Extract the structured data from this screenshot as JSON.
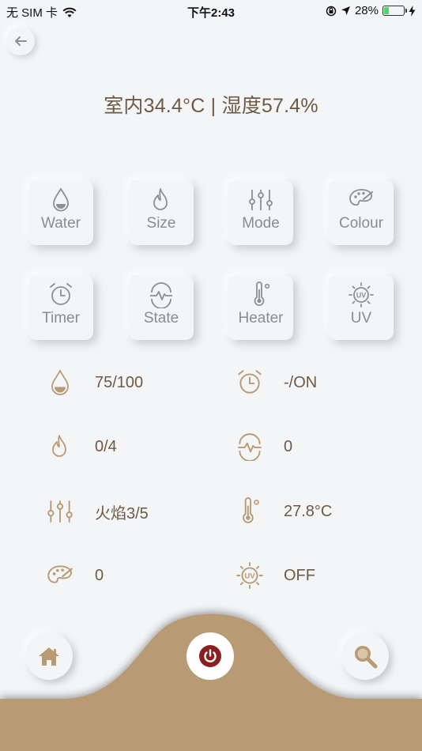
{
  "status_bar": {
    "carrier": "无 SIM 卡",
    "time": "下午2:43",
    "battery_percent": "28%",
    "battery_level": 0.28
  },
  "header": {
    "climate_readout": "室内34.4°C | 湿度57.4%"
  },
  "controls": {
    "row1": [
      {
        "label": "Water",
        "icon": "water-drop-icon"
      },
      {
        "label": "Size",
        "icon": "flame-icon"
      },
      {
        "label": "Mode",
        "icon": "sliders-icon"
      },
      {
        "label": "Colour",
        "icon": "palette-icon"
      }
    ],
    "row2": [
      {
        "label": "Timer",
        "icon": "alarm-clock-icon"
      },
      {
        "label": "State",
        "icon": "pulse-icon"
      },
      {
        "label": "Heater",
        "icon": "thermometer-icon"
      },
      {
        "label": "UV",
        "icon": "uv-sun-icon"
      }
    ]
  },
  "stats": {
    "water": "75/100",
    "timer": "-/ON",
    "size": "0/4",
    "state": "0",
    "mode": "火焰3/5",
    "heater": "27.8°C",
    "colour": "0",
    "uv": "OFF"
  },
  "bottom_nav": {
    "home_icon": "home-icon",
    "power_icon": "power-icon",
    "search_icon": "search-icon"
  },
  "colors": {
    "accent_brown": "#b89a74",
    "text_brown": "#6e5a44",
    "power_red": "#8b1f1f",
    "background": "#f3f5f7"
  }
}
